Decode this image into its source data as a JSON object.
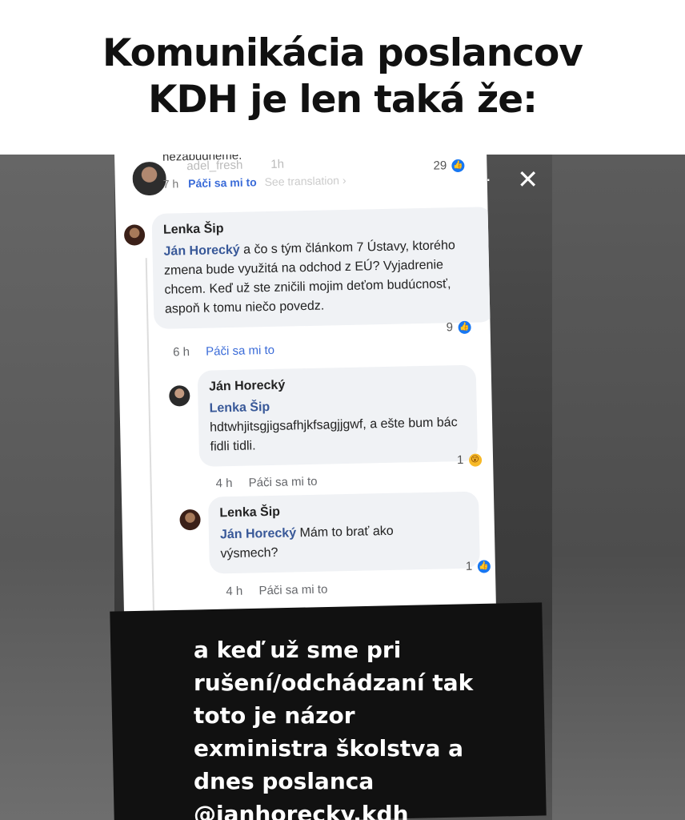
{
  "meme": {
    "line1": "Komunikácia poslancov",
    "line2": "KDH je len taká že:"
  },
  "story": {
    "more_icon": "more-dots-icon",
    "close_icon": "close-icon",
    "dots": "···",
    "close": "✕"
  },
  "screenshot": {
    "cut_text": "nezabudneme.",
    "ghost_handle": "adel_fresh",
    "ghost_time": "1h",
    "top_time": "7 h",
    "top_like": "Páči sa mi to",
    "top_translate": "See translation ›",
    "top_reaction_count": "29",
    "comments": [
      {
        "author": "Lenka Šip",
        "mention": "Ján Horecký",
        "text": " a čo s tým článkom 7 Ústavy, ktorého zmena bude využitá na odchod z EÚ? Vyjadrenie chcem. Keď už ste zničili mojim deťom budúcnosť, aspoň k tomu niečo povedz.",
        "time": "6 h",
        "like": "Páči sa mi to",
        "reaction_count": "9"
      },
      {
        "author": "Ján Horecký",
        "mention": "Lenka Šip",
        "text": "hdtwhjitsgjigsafhjkfsagjjgwf, a ešte bum bác fidli tidli.",
        "time": "4 h",
        "like": "Páči sa mi to",
        "reaction_count": "1"
      },
      {
        "author": "Lenka Šip",
        "mention": "Ján Horecký",
        "text": " Mám to brať ako výsmech?",
        "time": "4 h",
        "like": "Páči sa mi to",
        "reaction_count": "1"
      }
    ]
  },
  "caption": {
    "line1": "a keď už sme pri",
    "line2": "rušení/odchádzaní tak",
    "line3": "toto je názor",
    "line4": "exministra školstva a",
    "line5": "dnes poslanca",
    "line6": "@janhorecky.kdh"
  }
}
